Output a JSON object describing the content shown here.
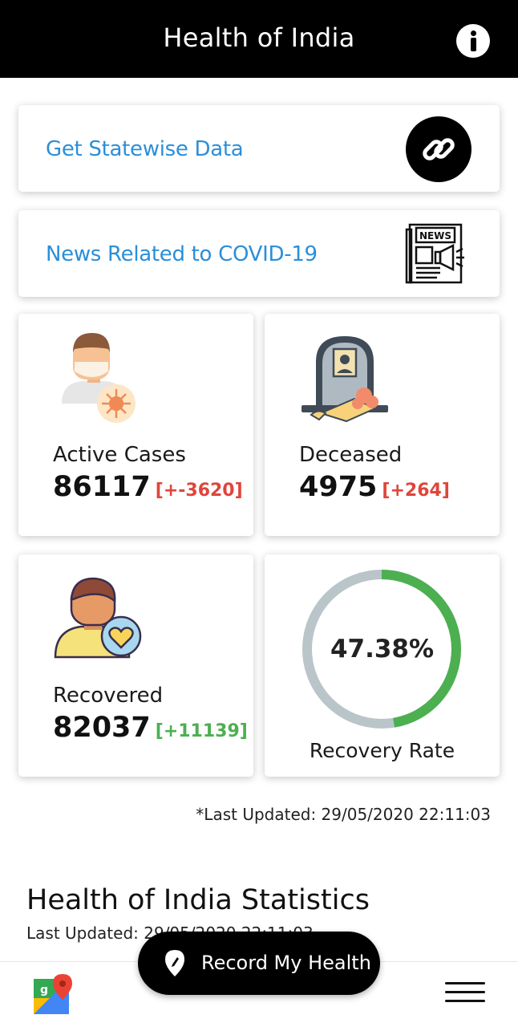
{
  "header": {
    "title": "Health of India"
  },
  "links": [
    {
      "label": "Get Statewise Data",
      "icon": "link-icon"
    },
    {
      "label": "News Related to COVID-19",
      "icon": "newspaper-icon"
    }
  ],
  "stats": {
    "active": {
      "label": "Active Cases",
      "value": "86117",
      "delta": "[+-3620]",
      "icon": "masked-person-icon"
    },
    "deceased": {
      "label": "Deceased",
      "value": "4975",
      "delta": "[+264]",
      "icon": "gravestone-icon"
    },
    "recovered": {
      "label": "Recovered",
      "value": "82037",
      "delta": "[+11139]",
      "icon": "recovered-person-icon"
    },
    "recovery_rate": {
      "label": "Recovery Rate",
      "value": "47.38%",
      "fraction": 0.4738
    }
  },
  "last_updated": "*Last Updated: 29/05/2020 22:11:03",
  "statistics": {
    "title": "Health of India Statistics",
    "subtitle": "Last Updated: 29/05/2020 22:11:03"
  },
  "fab": {
    "label": "Record My Health",
    "icon": "location-pin-icon"
  },
  "bottom_nav": {
    "left_icon": "google-maps-icon",
    "right_icon": "hamburger-menu-icon"
  },
  "colors": {
    "accent_blue": "#2a8fd8",
    "negative_red": "#e0453a",
    "positive_green": "#4caf50",
    "ring_track": "#b9c5c9"
  }
}
